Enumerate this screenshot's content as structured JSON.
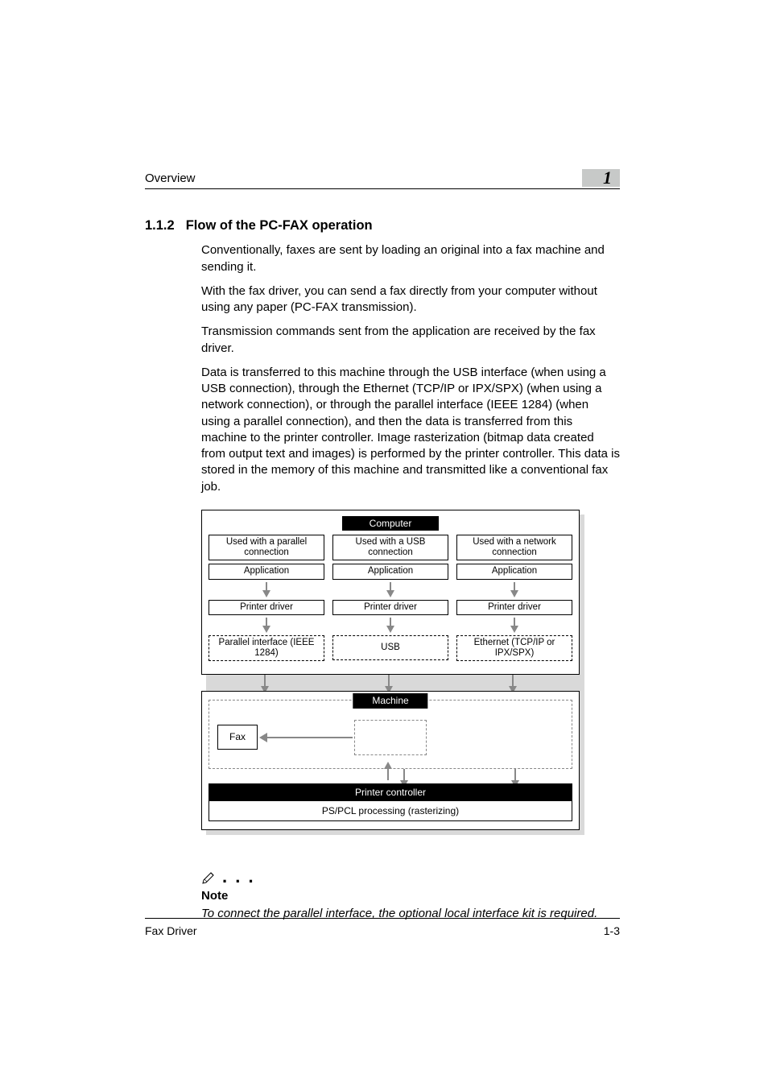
{
  "header": {
    "breadcrumb": "Overview",
    "chapter_number": "1"
  },
  "section": {
    "number": "1.1.2",
    "title": "Flow of the PC-FAX operation"
  },
  "paragraphs": {
    "p1": "Conventionally, faxes are sent by loading an original into a fax machine and sending it.",
    "p2": "With the fax driver, you can send a fax directly from your computer without using any paper (PC-FAX transmission).",
    "p3": "Transmission commands sent from the application are received by the fax driver.",
    "p4": "Data is transferred to this machine through the USB interface (when using a USB connection), through the Ethernet (TCP/IP or IPX/SPX) (when using a network connection), or through the parallel interface (IEEE 1284) (when using a parallel connection), and then the data is transferred from this machine to the printer controller. Image rasterization (bitmap data created from output text and images) is performed by the printer controller. This data is stored in the memory of this machine and transmitted like a conventional fax job."
  },
  "diagram": {
    "computer_label": "Computer",
    "columns": [
      {
        "header": "Used with a parallel connection",
        "app": "Application",
        "driver": "Printer driver",
        "iface": "Parallel interface (IEEE 1284)"
      },
      {
        "header": "Used with a USB connection",
        "app": "Application",
        "driver": "Printer driver",
        "iface": "USB"
      },
      {
        "header": "Used with a network connection",
        "app": "Application",
        "driver": "Printer driver",
        "iface": "Ethernet (TCP/IP or IPX/SPX)"
      }
    ],
    "machine_label": "Machine",
    "fax_label": "Fax",
    "printer_controller": "Printer controller",
    "rasterizing": "PS/PCL processing (rasterizing)"
  },
  "note": {
    "label": "Note",
    "body": "To connect the parallel interface, the optional local interface kit is required."
  },
  "footer": {
    "left": "Fax Driver",
    "right": "1-3"
  }
}
